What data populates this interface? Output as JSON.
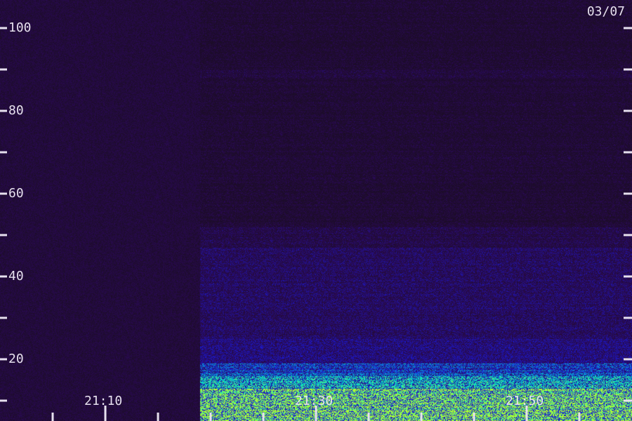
{
  "date_label": "03/07",
  "chart_data": {
    "type": "heatmap",
    "title": "",
    "xlabel": "",
    "ylabel": "",
    "y_ticks": [
      {
        "value": 20,
        "label": "20"
      },
      {
        "value": 40,
        "label": "40"
      },
      {
        "value": 60,
        "label": "60"
      },
      {
        "value": 80,
        "label": "80"
      },
      {
        "value": 100,
        "label": "100"
      }
    ],
    "y_minor_ticks": [
      10,
      30,
      50,
      70,
      90
    ],
    "ylim": [
      10,
      107
    ],
    "x_ticks": [
      {
        "value": "21:10",
        "label": "21:10"
      },
      {
        "value": "21:30",
        "label": "21:30"
      },
      {
        "value": "21:50",
        "label": "21:50"
      }
    ],
    "x_minor_ticks": [
      "21:05",
      "21:15",
      "21:20",
      "21:25",
      "21:35",
      "21:40",
      "21:45",
      "21:55",
      "22:00"
    ],
    "xlim": [
      "21:05",
      "22:00"
    ],
    "data_gap_end": "21:19",
    "bands": [
      {
        "from": 10,
        "to": 13,
        "intensity": 0.95
      },
      {
        "from": 13,
        "to": 16,
        "intensity": 0.75
      },
      {
        "from": 16,
        "to": 19,
        "intensity": 0.55
      },
      {
        "from": 19,
        "to": 25,
        "intensity": 0.32
      },
      {
        "from": 25,
        "to": 47,
        "intensity": 0.24
      },
      {
        "from": 47,
        "to": 52,
        "intensity": 0.16
      },
      {
        "from": 52,
        "to": 88,
        "intensity": 0.07
      },
      {
        "from": 88,
        "to": 90,
        "intensity": 0.12
      },
      {
        "from": 90,
        "to": 107,
        "intensity": 0.06
      }
    ],
    "colors": {
      "background": "#1c0c28",
      "low": "#2a0a55",
      "mid": "#1a1ad8",
      "high": "#00e0c8",
      "peak": "#b0ff30",
      "axis": "#e6e0ee"
    }
  }
}
